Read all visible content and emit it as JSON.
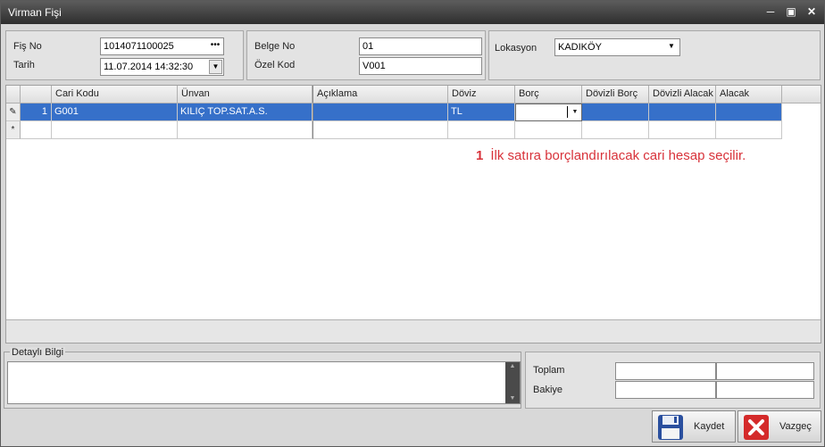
{
  "window": {
    "title": "Virman Fişi"
  },
  "header": {
    "fis_no_label": "Fiş No",
    "fis_no_value": "1014071100025",
    "fis_no_button": "•••",
    "tarih_label": "Tarih",
    "tarih_value": "11.07.2014 14:32:30",
    "belge_no_label": "Belge No",
    "belge_no_value": "01",
    "ozel_kod_label": "Özel Kod",
    "ozel_kod_value": "V001",
    "lokasyon_label": "Lokasyon",
    "lokasyon_value": "KADIKÖY"
  },
  "grid": {
    "columns": [
      "Cari Kodu",
      "Ünvan",
      "Açıklama",
      "Döviz",
      "Borç",
      "Dövizli Borç",
      "Dövizli Alacak",
      "Alacak"
    ],
    "rows": [
      {
        "no": "1",
        "cari_kodu": "G001",
        "unvan": "KILIÇ TOP.SAT.A.S.",
        "aciklama": "",
        "doviz": "TL",
        "borc": "",
        "dovizli_borc": "",
        "dovizli_alacak": "",
        "alacak": ""
      }
    ],
    "new_row_marker": "*"
  },
  "annotation": {
    "number": "1",
    "text": "İlk satıra borçlandırılacak cari hesap seçilir."
  },
  "detail": {
    "label": "Detaylı Bilgi"
  },
  "totals": {
    "toplam_label": "Toplam",
    "bakiye_label": "Bakiye"
  },
  "buttons": {
    "save": "Kaydet",
    "cancel": "Vazgeç"
  },
  "colors": {
    "selection": "#3670c9",
    "annotation": "#d8323a"
  }
}
